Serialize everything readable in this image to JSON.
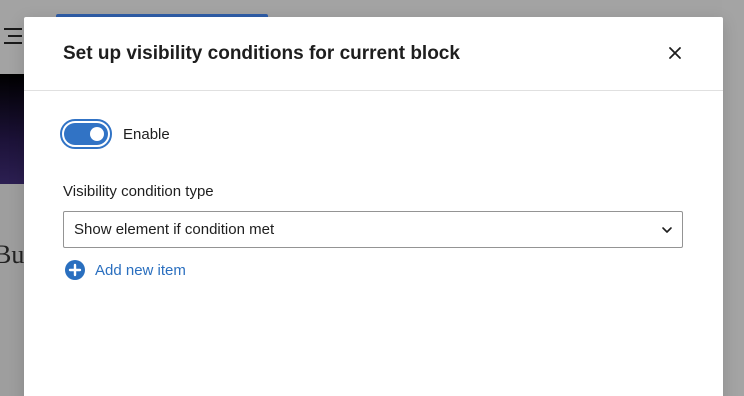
{
  "background": {
    "partial_heading": "Bus"
  },
  "dialog": {
    "title": "Set up visibility conditions for current block",
    "close_icon": "close-icon",
    "enable_toggle": {
      "label": "Enable",
      "checked": true
    },
    "condition_type": {
      "label": "Visibility condition type",
      "selected": "Show element if condition met"
    },
    "add_item": {
      "label": "Add new item",
      "icon": "plus-circle-icon"
    }
  },
  "colors": {
    "accent": "#3173c5",
    "link": "#2a6fbf",
    "overlay": "#9e9e9e"
  }
}
